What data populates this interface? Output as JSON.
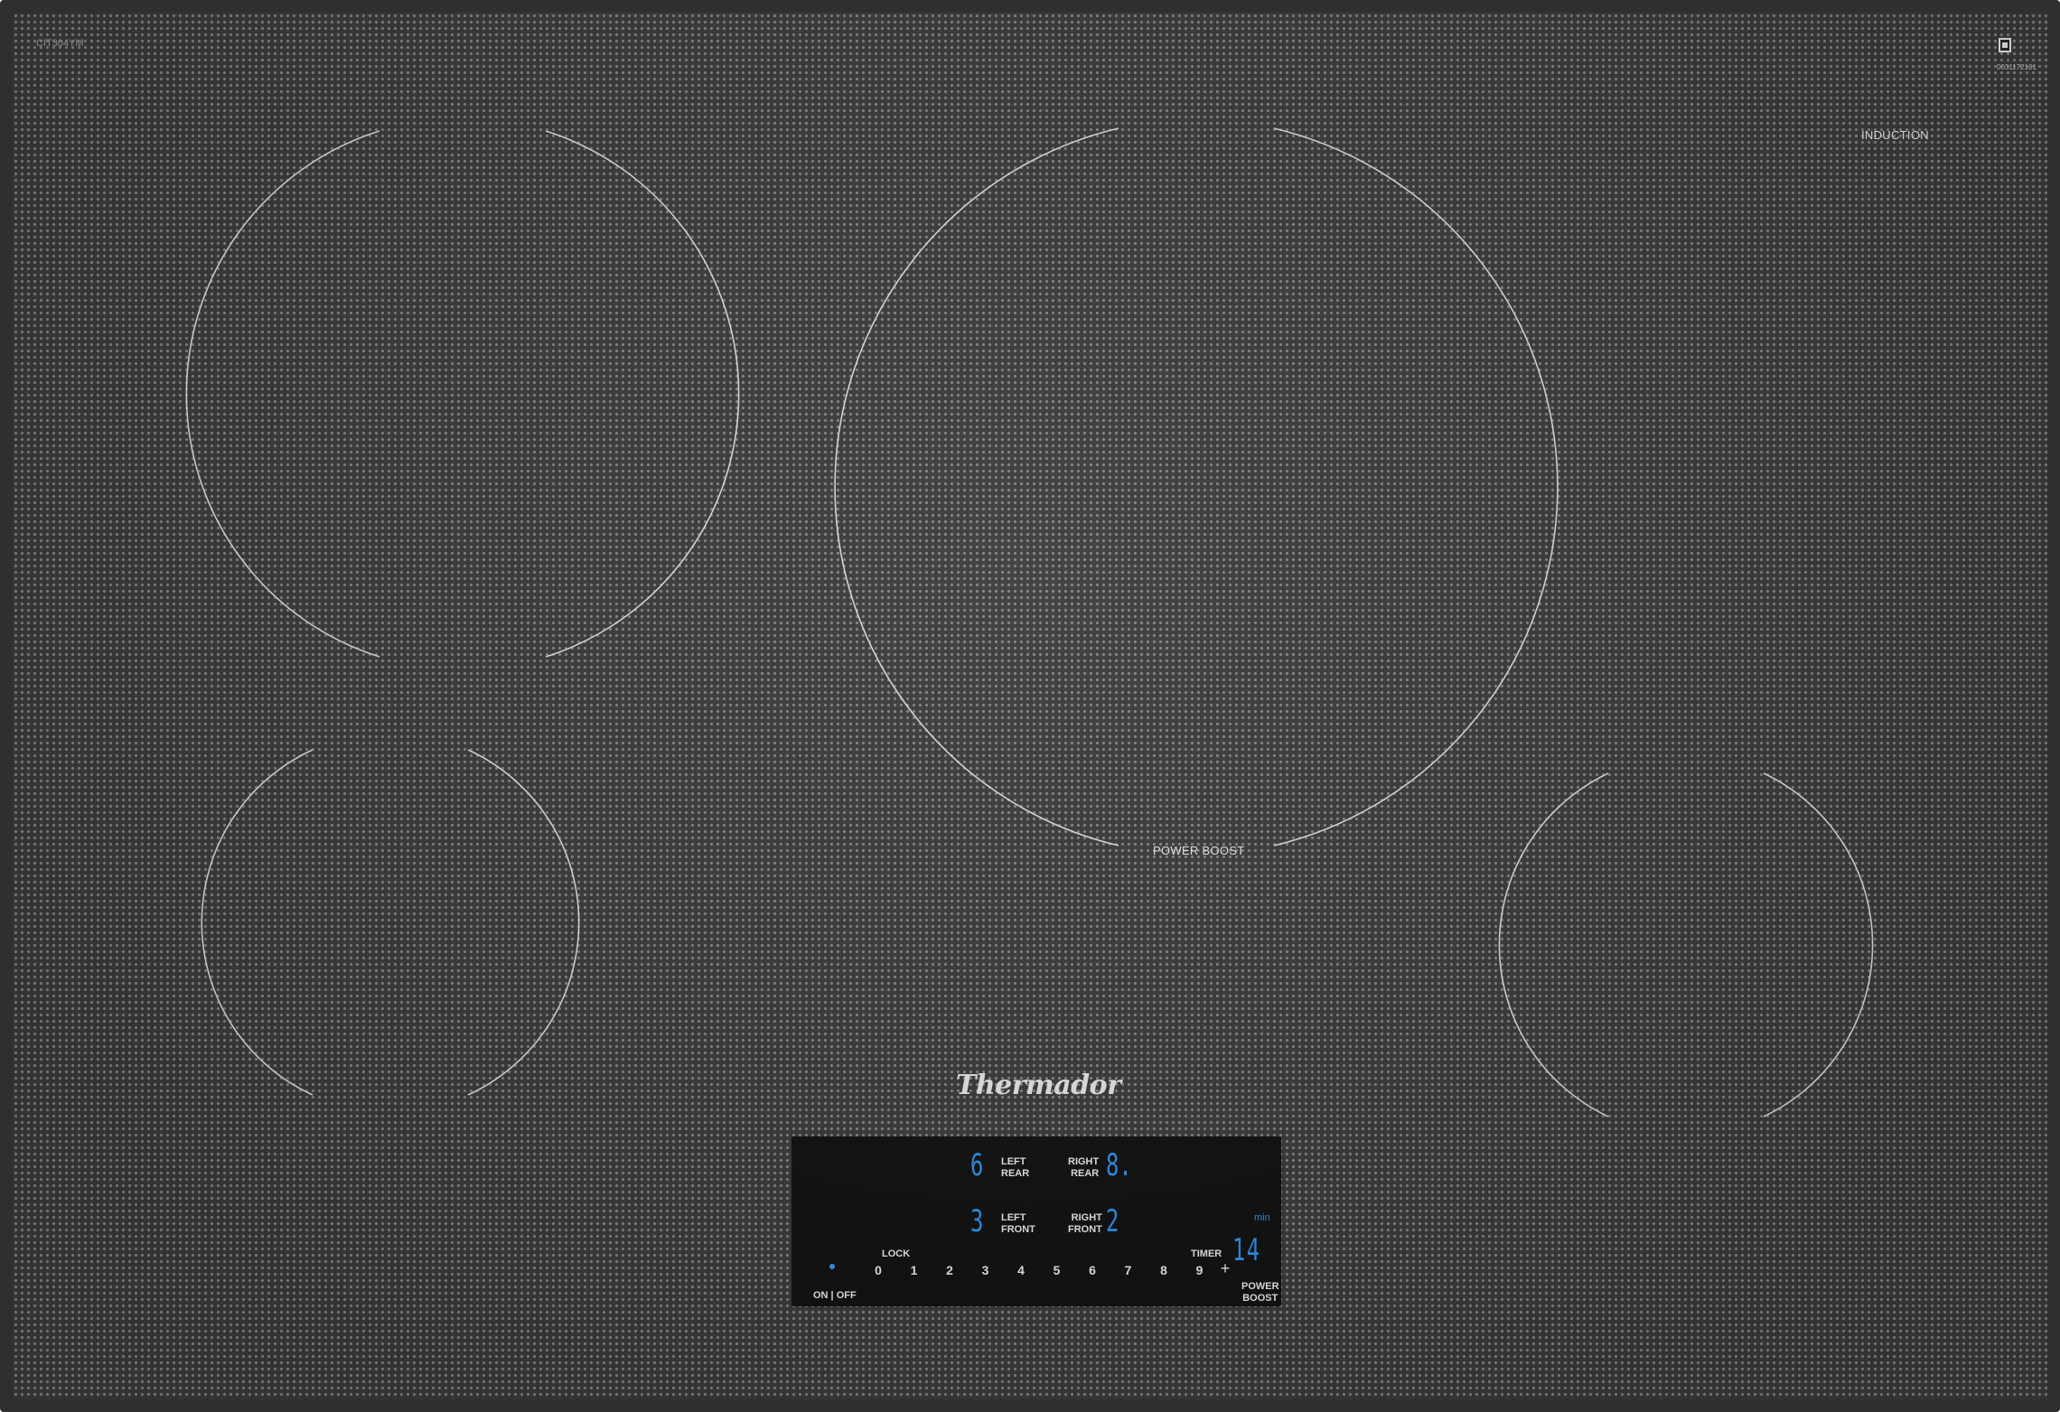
{
  "appliance": {
    "model": "CIT304YM",
    "serial": "0031172181",
    "cooking_type": "INDUCTION",
    "brand": "Thermador",
    "zone_label": "POWER BOOST"
  },
  "control_panel": {
    "left_rear": {
      "label_line1": "LEFT",
      "label_line2": "REAR",
      "level": "6"
    },
    "right_rear": {
      "label_line1": "RIGHT",
      "label_line2": "REAR",
      "level": "8."
    },
    "left_front": {
      "label_line1": "LEFT",
      "label_line2": "FRONT",
      "level": "3"
    },
    "right_front": {
      "label_line1": "RIGHT",
      "label_line2": "FRONT",
      "level": "2"
    },
    "lock_label": "LOCK",
    "timer": {
      "label": "TIMER",
      "value": "14",
      "unit": "min"
    },
    "on_off_label": "ON | OFF",
    "slider": [
      "0",
      "1",
      "2",
      "3",
      "4",
      "5",
      "6",
      "7",
      "8",
      "9"
    ],
    "plus_label": "+",
    "power_boost": {
      "line1": "POWER",
      "line2": "BOOST"
    },
    "display_color": "#2e8fe6"
  }
}
